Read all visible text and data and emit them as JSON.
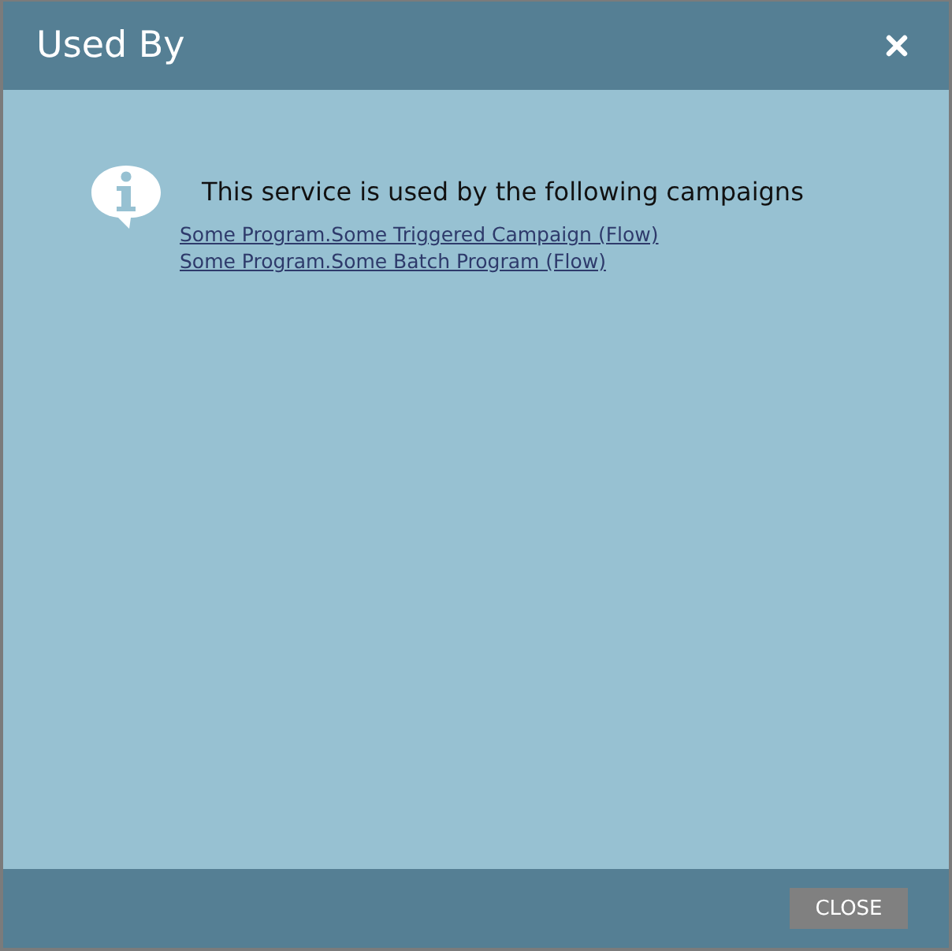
{
  "window": {
    "title": "Used By"
  },
  "message": "This service is used by the following campaigns",
  "links": [
    "Some Program.Some Triggered Campaign (Flow)",
    "Some Program.Some Batch Program (Flow)"
  ],
  "buttons": [
    {
      "label": "CLOSE"
    }
  ]
}
